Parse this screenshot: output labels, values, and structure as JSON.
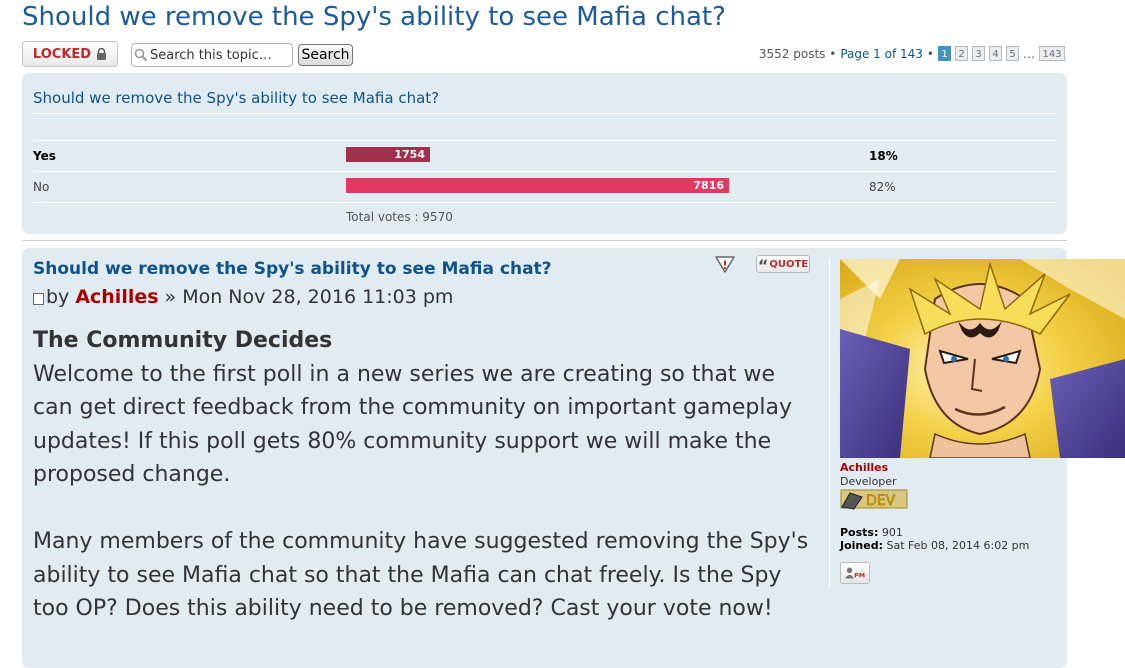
{
  "topic": {
    "title": "Should we remove the Spy's ability to see Mafia chat?",
    "locked_label": "LOCKED",
    "search_placeholder": "Search this topic…",
    "search_button": "Search",
    "pagination": {
      "summary": "3552 posts •",
      "page_label": "Page 1 of 143",
      "separator": "•",
      "pages": [
        "1",
        "2",
        "3",
        "4",
        "5"
      ],
      "ellipsis": "…",
      "last_page": "143",
      "current_page": 1
    }
  },
  "poll": {
    "title": "Should we remove the Spy's ability to see Mafia chat?",
    "options": [
      {
        "label": "Yes",
        "votes": "1754",
        "percent": "18%",
        "fraction": 0.18,
        "color": "#a0304b"
      },
      {
        "label": "No",
        "votes": "7816",
        "percent": "82%",
        "fraction": 0.82,
        "color": "#e3385f"
      }
    ],
    "total": "Total votes : 9570"
  },
  "post": {
    "title": "Should we remove the Spy's ability to see Mafia chat?",
    "by": "by",
    "author": "Achilles",
    "date": "» Mon Nov 28, 2016 11:03 pm",
    "quote_label": "QUOTE",
    "heading": "The Community Decides",
    "paragraph1": "Welcome to the first poll in a new series we are creating so that we can get direct feedback from the community on important gameplay updates! If this poll gets 80% community support we will make the proposed change.",
    "paragraph2": "Many members of the community have suggested removing the Spy's ability to see Mafia chat so that the Mafia can chat freely. Is the Spy too OP? Does this ability need to be removed? Cast your vote now!"
  },
  "profile": {
    "name": "Achilles",
    "rank": "Developer",
    "badge_text": "DEV",
    "posts_label": "Posts:",
    "posts_value": "901",
    "joined_label": "Joined:",
    "joined_value": "Sat Feb 08, 2014 6:02 pm",
    "pm_label": "PM"
  },
  "icons": [
    "lock-icon",
    "search-icon",
    "post-icon",
    "report-icon",
    "quote-icon",
    "avatar-image",
    "dev-rank-badge",
    "pm-icon"
  ]
}
